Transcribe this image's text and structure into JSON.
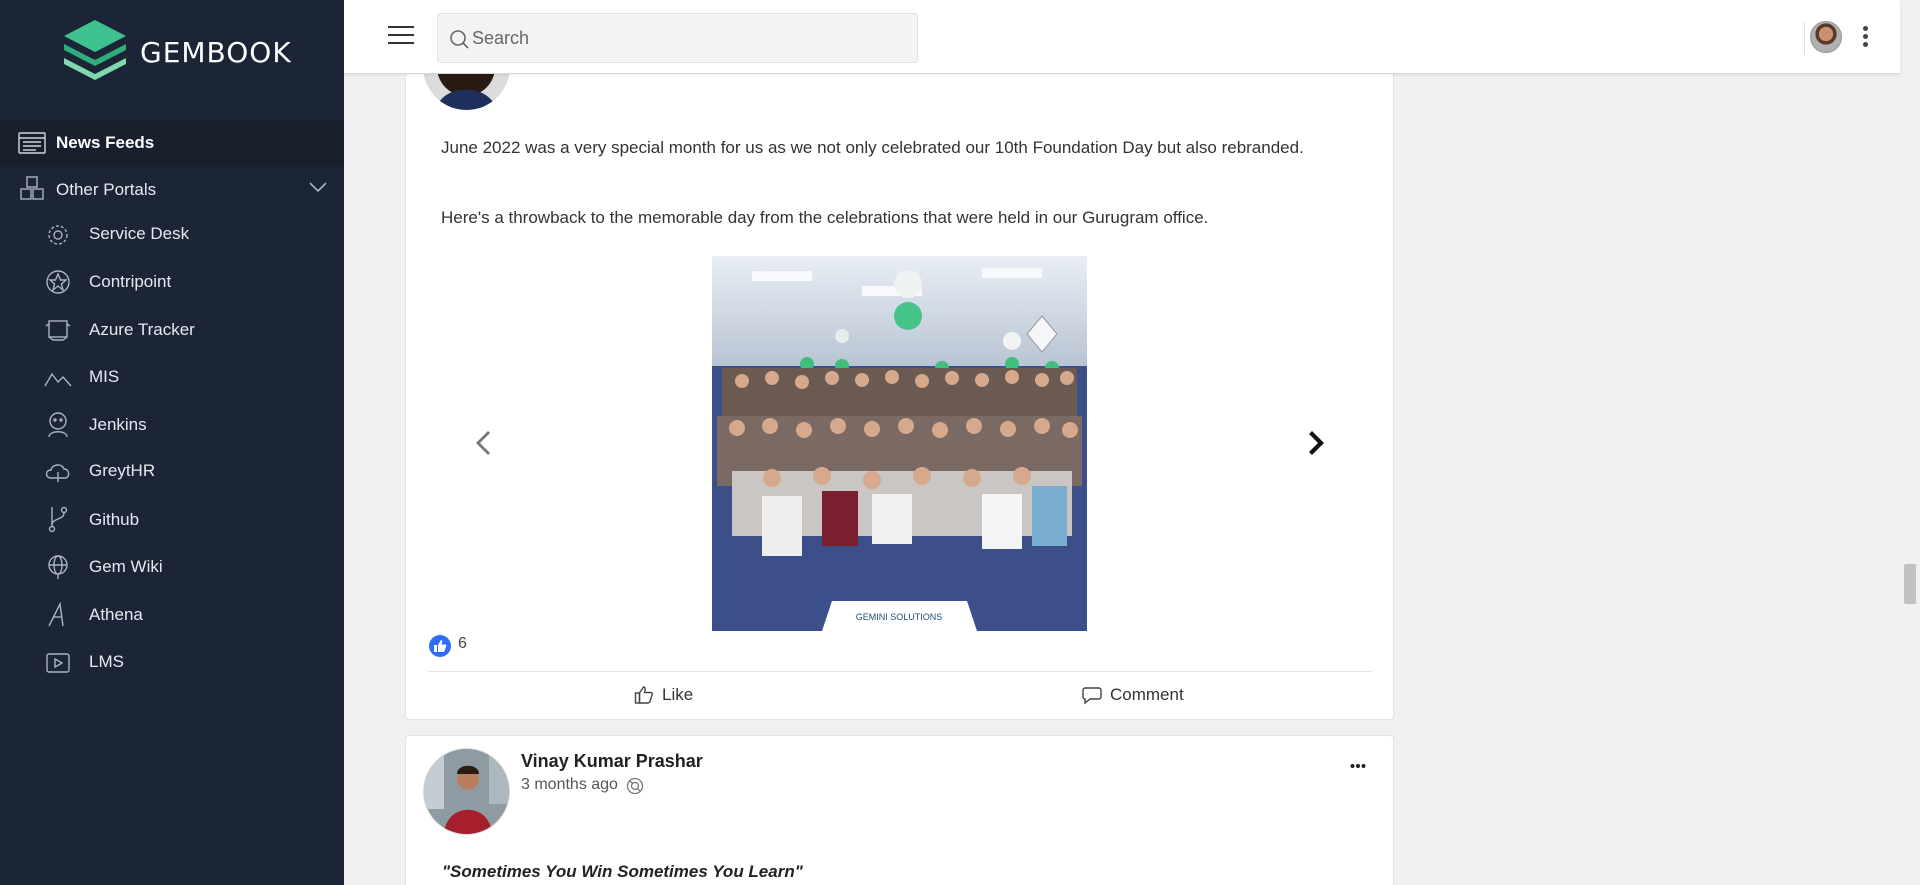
{
  "brand": {
    "name": "GEMBOOK"
  },
  "sidebar": {
    "items": [
      {
        "label": "News Feeds",
        "icon": "news-feed-icon",
        "active": true
      },
      {
        "label": "Other Portals",
        "icon": "portals-icon",
        "expandable": true
      },
      {
        "label": "Service Desk",
        "icon": "service-desk-icon"
      },
      {
        "label": "Contripoint",
        "icon": "contripoint-icon"
      },
      {
        "label": "Azure Tracker",
        "icon": "azure-tracker-icon"
      },
      {
        "label": "MIS",
        "icon": "mis-icon"
      },
      {
        "label": "Jenkins",
        "icon": "jenkins-icon"
      },
      {
        "label": "GreytHR",
        "icon": "greythr-icon"
      },
      {
        "label": "Github",
        "icon": "github-icon"
      },
      {
        "label": "Gem Wiki",
        "icon": "gem-wiki-icon"
      },
      {
        "label": "Athena",
        "icon": "athena-icon"
      },
      {
        "label": "LMS",
        "icon": "lms-icon"
      }
    ]
  },
  "header": {
    "search_placeholder": "Search"
  },
  "posts": [
    {
      "paragraph_1": "June 2022 was a very special month for us as we not only celebrated our 10th Foundation Day but also rebranded.",
      "paragraph_2": "Here's a throwback to the memorable day from the celebrations that were held in our Gurugram office.",
      "image_caption_logo": "GEMINI SOLUTIONS",
      "like_count": "6",
      "like_label": "Like",
      "comment_label": "Comment"
    },
    {
      "author": "Vinay Kumar Prashar",
      "time": "3 months ago",
      "text": "\"Sometimes You Win Sometimes You Learn\""
    }
  ],
  "colors": {
    "sidebar_bg": "#1c2536",
    "brand_green": "#3ec28f",
    "like_blue": "#2f6df2"
  }
}
